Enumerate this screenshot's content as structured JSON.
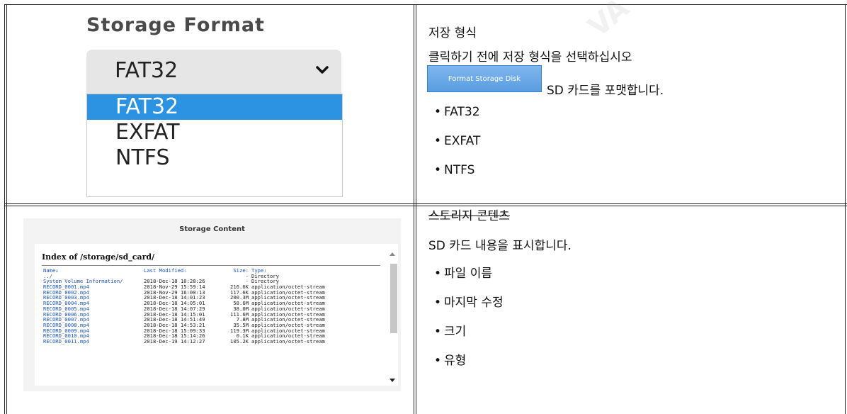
{
  "format_image": {
    "title": "Storage Format",
    "selected": "FAT32",
    "options": [
      "FAT32",
      "EXFAT",
      "NTFS"
    ],
    "highlighted_index": 0,
    "accent": "#2c92e2"
  },
  "format_desc": {
    "heading": "저장 형식",
    "instruction": "클릭하기 전에 저장 형식을 선택하십시오",
    "button_label": "Format Storage Disk",
    "button_desc": "SD 카드를 포맷합니다.",
    "bullets": [
      "FAT32",
      "EXFAT",
      "NTFS"
    ]
  },
  "content_image": {
    "title": "Storage Content",
    "index_title": "Index of /storage/sd_card/",
    "headers": {
      "name": "Name↓",
      "modified": "Last Modified:",
      "size": "Size:",
      "type": "Type:"
    },
    "rows": [
      {
        "name": "../",
        "modified": "",
        "size": "-",
        "type": "Directory"
      },
      {
        "name": "System Volume Information/",
        "modified": "2018-Dec-18 10:28:26",
        "size": "-",
        "type": "Directory"
      },
      {
        "name": "RECORD_0001.mp4",
        "modified": "2018-Nov-29 15:59:14",
        "size": "216.6K",
        "type": "application/octet-stream"
      },
      {
        "name": "RECORD_0002.mp4",
        "modified": "2018-Nov-29 16:00:13",
        "size": "117.6K",
        "type": "application/octet-stream"
      },
      {
        "name": "RECORD_0003.mp4",
        "modified": "2018-Dec-18 14:01:23",
        "size": "200.3M",
        "type": "application/octet-stream"
      },
      {
        "name": "RECORD_0004.mp4",
        "modified": "2018-Dec-18 14:05:01",
        "size": "58.6M",
        "type": "application/octet-stream"
      },
      {
        "name": "RECORD_0005.mp4",
        "modified": "2018-Dec-18 14:07:29",
        "size": "38.0M",
        "type": "application/octet-stream"
      },
      {
        "name": "RECORD_0006.mp4",
        "modified": "2018-Dec-18 14:15:01",
        "size": "111.6M",
        "type": "application/octet-stream"
      },
      {
        "name": "RECORD_0007.mp4",
        "modified": "2018-Dec-18 14:51:49",
        "size": "7.8M",
        "type": "application/octet-stream"
      },
      {
        "name": "RECORD_0008.mp4",
        "modified": "2018-Dec-18 14:53:21",
        "size": "35.5M",
        "type": "application/octet-stream"
      },
      {
        "name": "RECORD_0009.mp4",
        "modified": "2018-Dec-18 15:09:33",
        "size": "119.3M",
        "type": "application/octet-stream"
      },
      {
        "name": "RECORD_0010.mp4",
        "modified": "2018-Dec-18 15:14:26",
        "size": "0.1K",
        "type": "application/octet-stream"
      },
      {
        "name": "RECORD_0011.mp4",
        "modified": "2018-Dec-19 14:12:27",
        "size": "105.2K",
        "type": "application/octet-stream"
      }
    ]
  },
  "content_desc": {
    "heading": "스토리지 콘텐츠",
    "description": "SD 카드 내용을 표시합니다.",
    "bullets": [
      "파일 이름",
      "마지막 수정",
      "크기",
      "유형"
    ]
  }
}
